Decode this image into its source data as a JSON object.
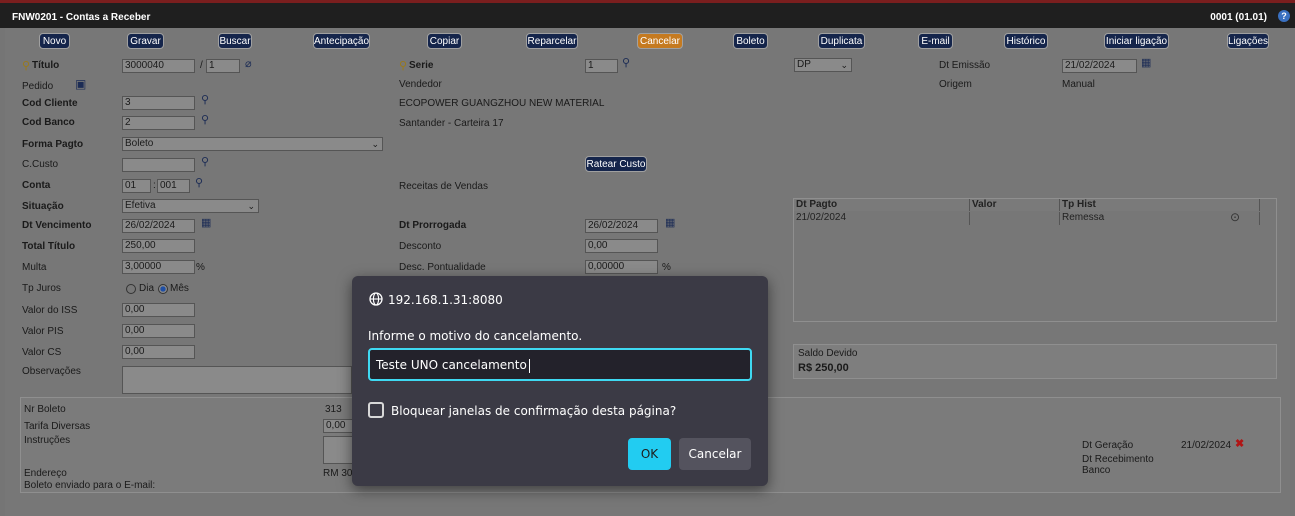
{
  "window": {
    "title": "FNW0201 - Contas a Receber",
    "company": "0001 (01.01)",
    "help_icon": "help-icon"
  },
  "toolbar": {
    "novo": "Novo",
    "gravar": "Gravar",
    "buscar": "Buscar",
    "antecipacao": "Antecipação",
    "copiar": "Copiar",
    "reparcelar": "Reparcelar",
    "cancelar": "Cancelar",
    "boleto": "Boleto",
    "duplicata": "Duplicata",
    "email": "E-mail",
    "historico": "Histórico",
    "iniciar_ligacao": "Iniciar ligação",
    "ligacoes": "Ligações",
    "active_color": "#c57a20",
    "button_color": "#15254b"
  },
  "form": {
    "titulo_label": "Título",
    "titulo_value": "3000040",
    "titulo_sep": "/",
    "titulo_parcela": "1",
    "serie_label": "Serie",
    "serie_value": "1",
    "tipo_value": "DP",
    "dt_emissao_label": "Dt Emissão",
    "dt_emissao_value": "21/02/2024",
    "pedido_label": "Pedido",
    "vendedor_label": "Vendedor",
    "origem_label": "Origem",
    "origem_value": "Manual",
    "cod_cliente_label": "Cod Cliente",
    "cod_cliente_value": "3",
    "cliente_nome": "ECOPOWER GUANGZHOU NEW MATERIAL",
    "cod_banco_label": "Cod Banco",
    "cod_banco_value": "2",
    "banco_nome": "Santander - Carteira 17",
    "forma_pagto_label": "Forma Pagto",
    "forma_pagto_value": "Boleto",
    "ccusto_label": "C.Custo",
    "ccusto_value": "",
    "ratear_custo": "Ratear Custo",
    "conta_label": "Conta",
    "conta_a": "01",
    "conta_sep": ":",
    "conta_b": "001",
    "conta_nome": "Receitas de Vendas",
    "situacao_label": "Situação",
    "situacao_value": "Efetiva",
    "dt_vencimento_label": "Dt Vencimento",
    "dt_vencimento_value": "26/02/2024",
    "dt_prorrogada_label": "Dt Prorrogada",
    "dt_prorrogada_value": "26/02/2024",
    "total_titulo_label": "Total Título",
    "total_titulo_value": "250,00",
    "desconto_label": "Desconto",
    "desconto_value": "0,00",
    "multa_label": "Multa",
    "multa_value": "3,00000",
    "multa_unit": "%",
    "desc_pontualidade_label": "Desc. Pontualidade",
    "desc_pontualidade_value": "0,00000",
    "desc_pontualidade_unit": "%",
    "tp_juros_label": "Tp Juros",
    "tp_juros_dia": "Dia",
    "tp_juros_mes": "Mês",
    "tp_juros_selected": "Mês",
    "valor_iss_label": "Valor do ISS",
    "valor_iss_value": "0,00",
    "valor_pis_label": "Valor PIS",
    "valor_pis_value": "0,00",
    "valor_cs_label": "Valor CS",
    "valor_cs_value": "0,00",
    "observacoes_label": "Observações",
    "observacoes_value": ""
  },
  "history_table": {
    "columns": [
      "Dt Pagto",
      "Valor",
      "Tp Hist"
    ],
    "rows": [
      {
        "dt_pagto": "21/02/2024",
        "valor": "",
        "tp_hist": "Remessa"
      }
    ]
  },
  "saldo": {
    "label": "Saldo Devido",
    "value": "R$ 250,00"
  },
  "boleto": {
    "nr_boleto_label": "Nr Boleto",
    "nr_boleto_value": "313",
    "tarifa_label": "Tarifa Diversas",
    "tarifa_value": "0,00",
    "instrucoes_label": "Instruções",
    "endereco_label": "Endereço",
    "endereco_value": "RM 30",
    "email_label": "Boleto enviado para o E-mail:",
    "dt_geracao_label": "Dt Geração",
    "dt_geracao_value": "21/02/2024",
    "dt_recebimento_label": "Dt Recebimento",
    "banco_label": "Banco"
  },
  "dialog": {
    "host": "192.168.1.31:8080",
    "message": "Informe o motivo do cancelamento.",
    "input_value": "Teste UNO cancelamento",
    "checkbox_label": "Bloquear janelas de confirmação desta página?",
    "ok": "OK",
    "cancel": "Cancelar",
    "accent": "#22ccf1"
  }
}
